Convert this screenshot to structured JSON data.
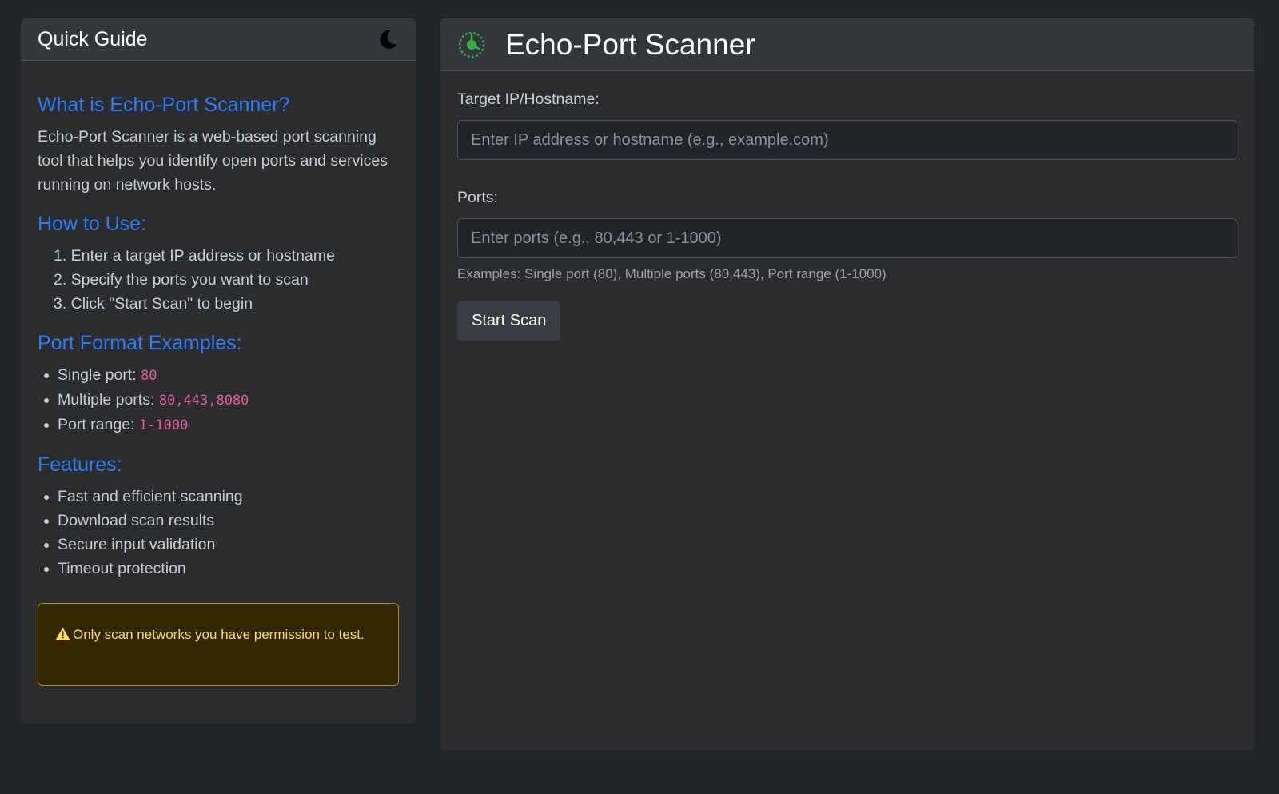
{
  "guide": {
    "title": "Quick Guide",
    "theme_toggle_icon": "moon-icon",
    "about": {
      "heading": "What is Echo-Port Scanner?",
      "text": "Echo-Port Scanner is a web-based port scanning tool that helps you identify open ports and services running on network hosts."
    },
    "how_to": {
      "heading": "How to Use:",
      "steps": [
        "1. Enter a target IP address or hostname",
        "2. Specify the ports you want to scan",
        "3. Click \"Start Scan\" to begin"
      ]
    },
    "port_formats": {
      "heading": "Port Format Examples:",
      "items": [
        {
          "label": "Single port: ",
          "code": "80"
        },
        {
          "label": "Multiple ports: ",
          "code": "80,443,8080"
        },
        {
          "label": "Port range: ",
          "code": "1-1000"
        }
      ]
    },
    "features": {
      "heading": "Features:",
      "items": [
        "Fast and efficient scanning",
        "Download scan results",
        "Secure input validation",
        "Timeout protection"
      ]
    },
    "warning": {
      "icon": "warning-triangle-icon",
      "text": "Only scan networks you have permission to test."
    }
  },
  "scanner": {
    "title": "Echo-Port Scanner",
    "logo_icon": "radar-icon",
    "target": {
      "label": "Target IP/Hostname:",
      "value": "",
      "placeholder": "Enter IP address or hostname (e.g., example.com)"
    },
    "ports": {
      "label": "Ports:",
      "value": "",
      "placeholder": "Enter ports (e.g., 80,443 or 1-1000)",
      "help": "Examples: Single port (80), Multiple ports (80,443), Port range (1-1000)"
    },
    "start_button_label": "Start Scan"
  },
  "colors": {
    "page_background": "#212529",
    "card_background": "#2b2c2e",
    "heading_accent": "#2f7bf6",
    "code_text": "#e05d9c",
    "warning_text": "#ffda6a",
    "warning_border": "#b58a10",
    "logo_green": "#2fb344"
  }
}
